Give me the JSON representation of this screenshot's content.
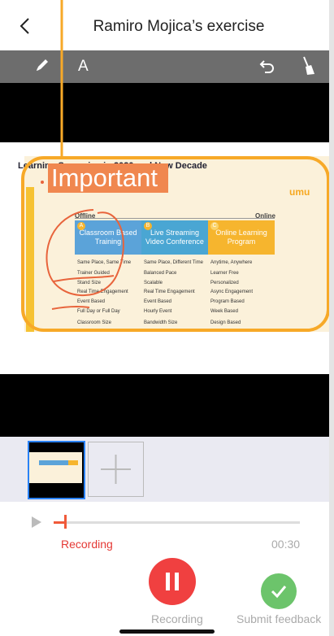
{
  "header": {
    "title": "Ramiro Mojica’s exercise",
    "back_icon": "chevron-left-icon"
  },
  "toolbar": {
    "text_tool": "A",
    "icons": [
      "pen-icon",
      "undo-icon",
      "broom-icon"
    ]
  },
  "slide": {
    "title": "Learning Scenarios in 2020 and New Decade",
    "logo": "umu",
    "offline_label": "Offline",
    "online_label": "Online",
    "columns": [
      {
        "badge": "A",
        "header": "Classroom Based Training",
        "items": [
          "Same Place, Same Time",
          "Trainer Guided",
          "Stand Size",
          "Real Time Engagement",
          "Event Based",
          "Full Day or Full Day",
          "Classroom Size"
        ]
      },
      {
        "badge": "B",
        "header": "Live Streaming Video Conference",
        "items": [
          "Same Place, Different Time",
          "Balanced Pace",
          "Scalable",
          "Real Time Engagement",
          "Event Based",
          "Hourly Event",
          "Bandwidth Size"
        ]
      },
      {
        "badge": "C",
        "header": "Online Learning Program",
        "items": [
          "Anytime, Anywhere",
          "Learner Free",
          "Personalized",
          "Async Engagement",
          "Program Based",
          "Week Based",
          "Design Based"
        ]
      }
    ],
    "annotation_text": "Important"
  },
  "player": {
    "status": "Recording",
    "time": "00:30",
    "progress": 0.05
  },
  "actions": {
    "pause_caption": "Recording",
    "submit_caption": "Submit feedback"
  },
  "colors": {
    "accent": "#f05a3a",
    "annotation_orange": "#f7a928",
    "submit_green": "#6cc46b"
  }
}
